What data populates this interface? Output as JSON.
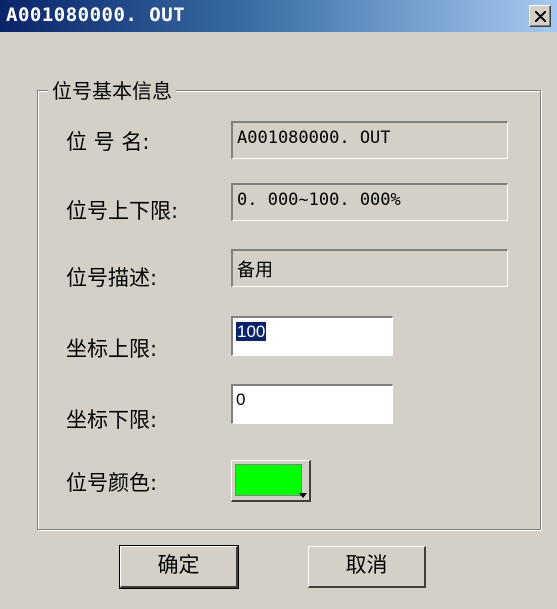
{
  "window": {
    "title": "A001080000. OUT",
    "close_glyph": "×"
  },
  "group": {
    "title": "位号基本信息"
  },
  "fields": {
    "tag_name": {
      "label": "位 号 名:",
      "value": "A001080000. OUT"
    },
    "tag_range": {
      "label": "位号上下限:",
      "value": "0. 000~100. 000%"
    },
    "tag_desc": {
      "label": "位号描述:",
      "value": "备用"
    },
    "coord_upper": {
      "label": "坐标上限:",
      "value": "100"
    },
    "coord_lower": {
      "label": "坐标下限:",
      "value": "0"
    },
    "tag_color": {
      "label": "位号颜色:",
      "color": "#00ff00"
    }
  },
  "buttons": {
    "ok": "确定",
    "cancel": "取消"
  }
}
